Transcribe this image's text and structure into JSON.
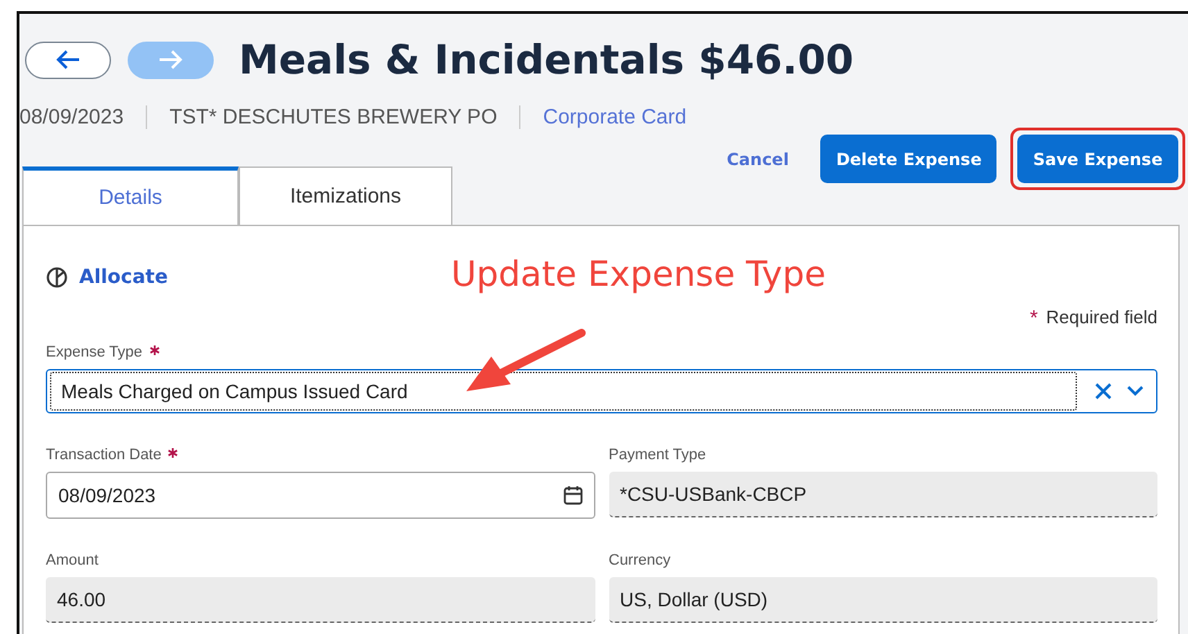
{
  "nav": {
    "back_disabled": false,
    "forward_disabled": true
  },
  "title": "Meals & Incidentals $46.00",
  "meta": [
    {
      "text": "08/09/2023",
      "kind": "text"
    },
    {
      "text": "TST* DESCHUTES BREWERY PO",
      "kind": "text"
    },
    {
      "text": "Corporate Card",
      "kind": "link"
    }
  ],
  "actions": [
    {
      "label": "Cancel",
      "kind": "link",
      "highlighted": false
    },
    {
      "label": "Delete Expense",
      "kind": "primary",
      "highlighted": false
    },
    {
      "label": "Save Expense",
      "kind": "primary",
      "highlighted": true
    }
  ],
  "tabs": [
    {
      "label": "Details",
      "selected": true
    },
    {
      "label": "Itemizations",
      "selected": false
    }
  ],
  "allocate": "Allocate",
  "required_note": {
    "mark": "*",
    "text": "Required field"
  },
  "expense_type": {
    "label": "Expense Type",
    "required": true,
    "value": "Meals Charged on Campus Issued Card"
  },
  "fields": [
    {
      "label": "Transaction Date",
      "required": true,
      "value": "08/09/2023",
      "disabled": false,
      "kind": "date"
    },
    {
      "label": "Payment Type",
      "required": false,
      "value": "*CSU-USBank-CBCP",
      "disabled": true,
      "kind": "text"
    },
    {
      "label": "Amount",
      "required": false,
      "value": "46.00",
      "disabled": true,
      "kind": "text"
    },
    {
      "label": "Currency",
      "required": false,
      "value": "US, Dollar (USD)",
      "disabled": true,
      "kind": "text"
    }
  ],
  "annotation": {
    "text": "Update Expense Type"
  }
}
